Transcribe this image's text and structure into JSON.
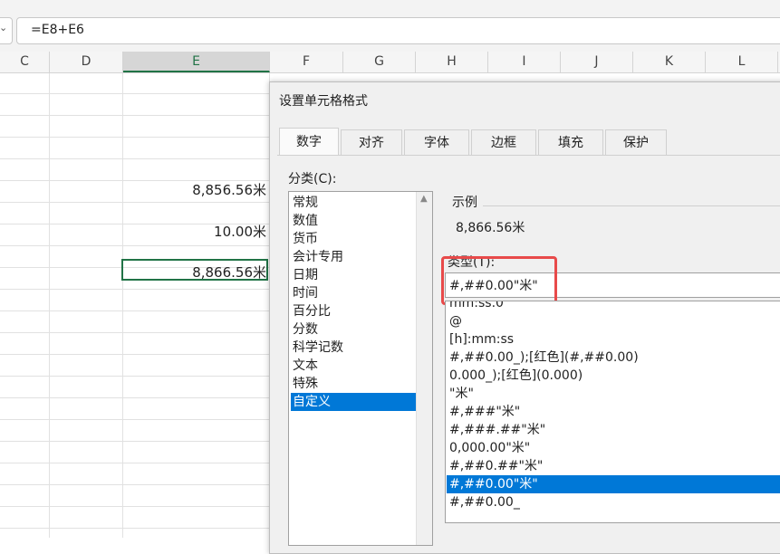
{
  "formula_bar": {
    "formula": "=E8+E6"
  },
  "columns": [
    "C",
    "D",
    "E",
    "F",
    "G",
    "H",
    "I",
    "J",
    "K",
    "L"
  ],
  "cells": {
    "e4": "8,856.56米",
    "e6": "10.00米",
    "e8": "8,866.56米"
  },
  "dialog": {
    "title": "设置单元格格式",
    "tabs": [
      "数字",
      "对齐",
      "字体",
      "边框",
      "填充",
      "保护"
    ],
    "category_label": "分类(C):",
    "categories": [
      "常规",
      "数值",
      "货币",
      "会计专用",
      "日期",
      "时间",
      "百分比",
      "分数",
      "科学记数",
      "文本",
      "特殊",
      "自定义"
    ],
    "selected_category": "自定义",
    "sample_label": "示例",
    "sample_value": "8,866.56米",
    "type_label": "类型(T):",
    "type_value": "#,##0.00\"米\"",
    "formats": [
      "mm:ss.0",
      "@",
      "[h]:mm:ss",
      "#,##0.00_);[红色](#,##0.00)",
      "0.000_);[红色](0.000)",
      "\"米\"",
      "#,###\"米\"",
      "#,###.##\"米\"",
      "0,000.00\"米\"",
      "#,##0.##\"米\"",
      "#,##0.00\"米\"",
      "#,##0.00_"
    ],
    "selected_format": "#,##0.00\"米\""
  },
  "colors": {
    "accent": "#0078d7",
    "excel_green": "#217346",
    "highlight_red": "#e84a4a"
  }
}
